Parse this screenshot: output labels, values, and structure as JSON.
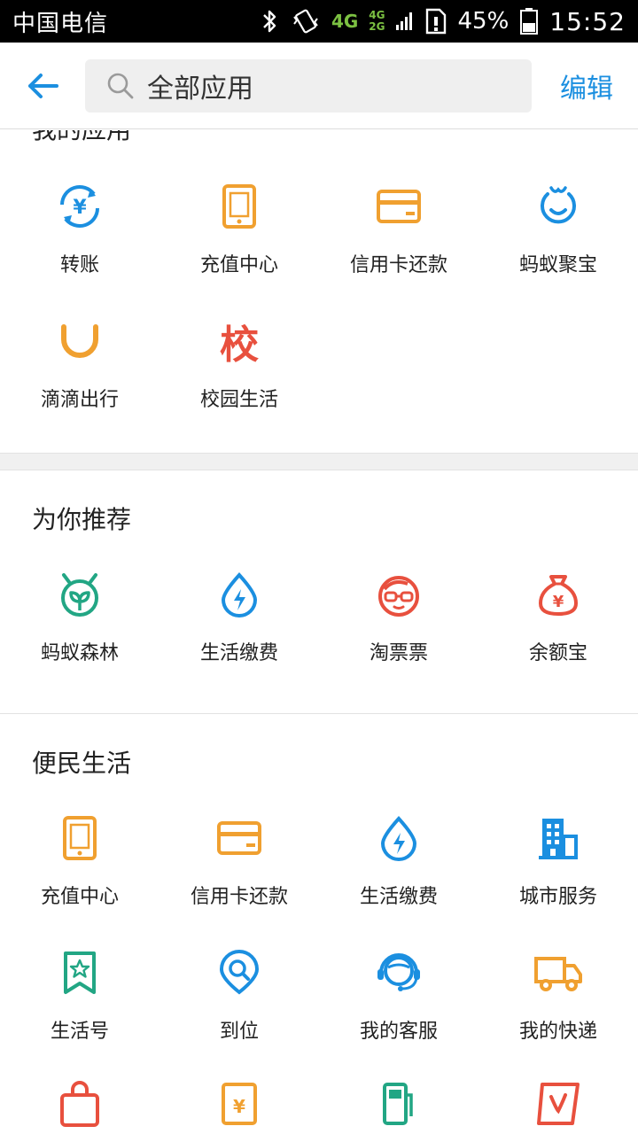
{
  "status_bar": {
    "carrier": "中国电信",
    "network_main": "4G",
    "network_small_top": "4G",
    "network_small_bottom": "2G",
    "battery": "45%",
    "time": "15:52"
  },
  "header": {
    "search_text": "全部应用",
    "edit_label": "编辑"
  },
  "sections": {
    "my_apps": {
      "title": "我的应用",
      "items": [
        {
          "label": "转账",
          "icon": "transfer-icon"
        },
        {
          "label": "充值中心",
          "icon": "phone-icon"
        },
        {
          "label": "信用卡还款",
          "icon": "credit-card-icon"
        },
        {
          "label": "蚂蚁聚宝",
          "icon": "antfortune-icon"
        },
        {
          "label": "滴滴出行",
          "icon": "didi-icon"
        },
        {
          "label": "校园生活",
          "icon": "campus-icon",
          "glyph": "校"
        }
      ]
    },
    "recommend": {
      "title": "为你推荐",
      "items": [
        {
          "label": "蚂蚁森林",
          "icon": "forest-icon"
        },
        {
          "label": "生活缴费",
          "icon": "utility-drop-icon"
        },
        {
          "label": "淘票票",
          "icon": "taopiaopiao-icon"
        },
        {
          "label": "余额宝",
          "icon": "money-bag-icon"
        }
      ]
    },
    "convenience": {
      "title": "便民生活",
      "items": [
        {
          "label": "充值中心",
          "icon": "phone-icon"
        },
        {
          "label": "信用卡还款",
          "icon": "credit-card-icon"
        },
        {
          "label": "生活缴费",
          "icon": "utility-drop-icon"
        },
        {
          "label": "城市服务",
          "icon": "building-icon"
        },
        {
          "label": "生活号",
          "icon": "bookmark-star-icon"
        },
        {
          "label": "到位",
          "icon": "location-search-icon"
        },
        {
          "label": "我的客服",
          "icon": "customer-service-icon"
        },
        {
          "label": "我的快递",
          "icon": "truck-icon"
        }
      ]
    }
  },
  "colors": {
    "blue": "#1b8fe0",
    "orange": "#f0a030",
    "red": "#e8503e",
    "green": "#22a684",
    "header_accent": "#1b8fe0"
  }
}
